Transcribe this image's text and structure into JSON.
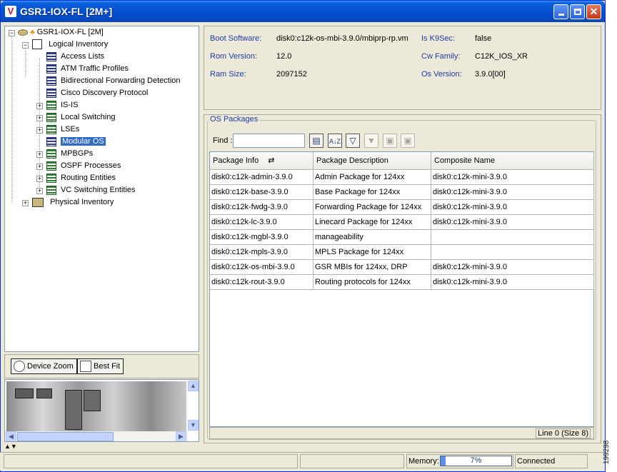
{
  "window": {
    "title": "GSR1-IOX-FL [2M+]",
    "app_icon_glyph": "V"
  },
  "tree": {
    "root": "GSR1-IOX-FL [2M]",
    "logical_inventory": "Logical Inventory",
    "items": [
      {
        "label": "Access Lists",
        "expandable": false
      },
      {
        "label": "ATM Traffic Profiles",
        "expandable": false
      },
      {
        "label": "Bidirectional Forwarding Detection",
        "expandable": false
      },
      {
        "label": "Cisco Discovery Protocol",
        "expandable": false
      },
      {
        "label": "IS-IS",
        "expandable": true
      },
      {
        "label": "Local Switching",
        "expandable": true
      },
      {
        "label": "LSEs",
        "expandable": true
      },
      {
        "label": "Modular OS",
        "expandable": false,
        "selected": true
      },
      {
        "label": "MPBGPs",
        "expandable": true
      },
      {
        "label": "OSPF Processes",
        "expandable": true
      },
      {
        "label": "Routing Entities",
        "expandable": true
      },
      {
        "label": "VC Switching Entities",
        "expandable": true
      }
    ],
    "physical_inventory": "Physical Inventory"
  },
  "zoom": {
    "device_zoom": "Device Zoom",
    "best_fit": "Best Fit"
  },
  "info": {
    "boot_software_label": "Boot Software:",
    "boot_software": "disk0:c12k-os-mbi-3.9.0/mbiprp-rp.vm",
    "rom_version_label": "Rom Version:",
    "rom_version": "12.0",
    "ram_size_label": "Ram Size:",
    "ram_size": "2097152",
    "k9sec_label": "Is K9Sec:",
    "k9sec": "false",
    "cw_family_label": "Cw Family:",
    "cw_family": "C12K_IOS_XR",
    "os_version_label": "Os Version:",
    "os_version": "3.9.0[00]"
  },
  "packages": {
    "group_title": "OS Packages",
    "find_label": "Find :",
    "find_value": "",
    "columns": [
      "Package Info",
      "Package Description",
      "Composite Name"
    ],
    "rows": [
      [
        "disk0:c12k-admin-3.9.0",
        "Admin Package for 124xx",
        "disk0:c12k-mini-3.9.0"
      ],
      [
        "disk0:c12k-base-3.9.0",
        "Base Package for 124xx",
        "disk0:c12k-mini-3.9.0"
      ],
      [
        "disk0:c12k-fwdg-3.9.0",
        "Forwarding Package for 124xx",
        "disk0:c12k-mini-3.9.0"
      ],
      [
        "disk0:c12k-lc-3.9.0",
        "Linecard Package for 124xx",
        "disk0:c12k-mini-3.9.0"
      ],
      [
        "disk0:c12k-mgbl-3.9.0",
        "manageability",
        ""
      ],
      [
        "disk0:c12k-mpls-3.9.0",
        "MPLS Package for 124xx",
        ""
      ],
      [
        "disk0:c12k-os-mbi-3.9.0",
        "GSR MBIs for 124xx, DRP",
        "disk0:c12k-mini-3.9.0"
      ],
      [
        "disk0:c12k-rout-3.9.0",
        "Routing protocols for 124xx",
        "disk0:c12k-mini-3.9.0"
      ]
    ],
    "footer": "Line 0 (Size 8)"
  },
  "status": {
    "memory_label": "Memory:",
    "memory_percent": "7%",
    "memory_fraction": 0.07,
    "connection": "Connected"
  },
  "figure_id": "199298"
}
